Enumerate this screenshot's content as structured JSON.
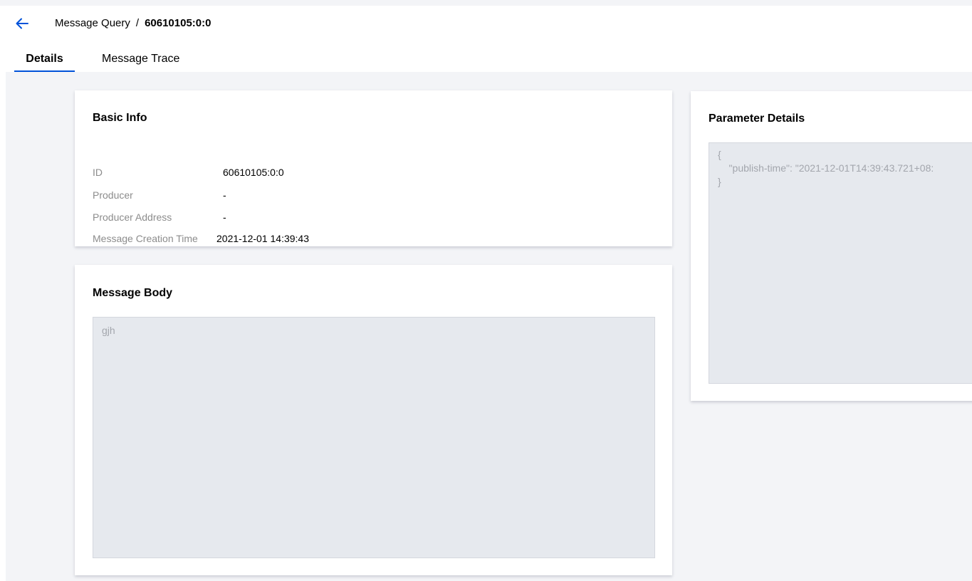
{
  "header": {
    "back_icon": "arrow-left-icon",
    "breadcrumb_parent": "Message Query",
    "breadcrumb_separator": "/",
    "breadcrumb_current": "60610105:0:0",
    "accent_color": "#0052d9"
  },
  "tabs": [
    {
      "label": "Details",
      "active": true
    },
    {
      "label": "Message Trace",
      "active": false
    }
  ],
  "basic_info": {
    "title": "Basic Info",
    "rows": [
      {
        "label": "ID",
        "value": "60610105:0:0"
      },
      {
        "label": "Producer",
        "value": "-"
      },
      {
        "label": "Producer Address",
        "value": "-"
      },
      {
        "label": "Message Creation Time",
        "value": "2021-12-01 14:39:43"
      }
    ]
  },
  "message_body": {
    "title": "Message Body",
    "content": "gjh"
  },
  "parameter_details": {
    "title": "Parameter Details",
    "lines": [
      "{",
      "    \"publish-time\": \"2021-12-01T14:39:43.721+08:",
      "}"
    ]
  }
}
